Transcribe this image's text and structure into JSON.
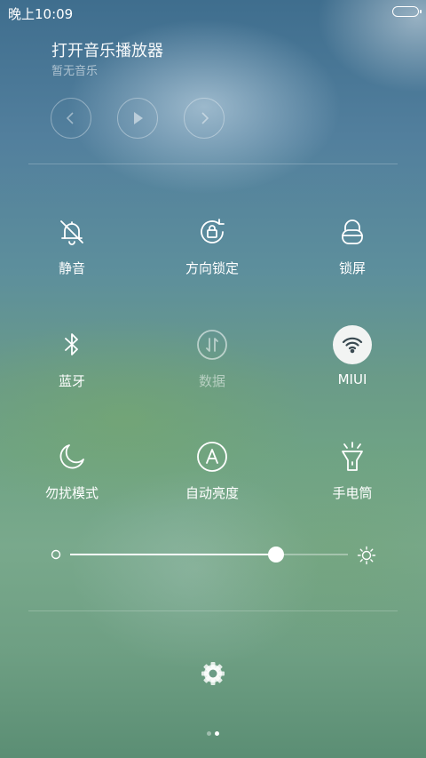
{
  "status_bar": {
    "time": "晚上10:09",
    "battery_icon": "battery-icon"
  },
  "music": {
    "title": "打开音乐播放器",
    "subtitle": "暂无音乐",
    "controls": [
      "previous-icon",
      "play-icon",
      "next-icon"
    ]
  },
  "toggles": [
    {
      "label": "静音",
      "icon": "bell-off-icon"
    },
    {
      "label": "方向锁定",
      "icon": "rotation-lock-icon"
    },
    {
      "label": "锁屏",
      "icon": "lock-icon"
    },
    {
      "label": "蓝牙",
      "icon": "bluetooth-icon"
    },
    {
      "label": "数据",
      "icon": "data-icon"
    },
    {
      "label": "MIUI",
      "icon": "wifi-icon"
    },
    {
      "label": "勿扰模式",
      "icon": "moon-icon"
    },
    {
      "label": "自动亮度",
      "icon": "auto-brightness-icon"
    },
    {
      "label": "手电筒",
      "icon": "flashlight-icon"
    }
  ],
  "brightness": {
    "level": 0.74
  },
  "page_indicator": {
    "count": 2,
    "current": 2
  },
  "colors": {
    "active_toggle_bg": "#f2f4f3",
    "accent": "#ffffff"
  }
}
